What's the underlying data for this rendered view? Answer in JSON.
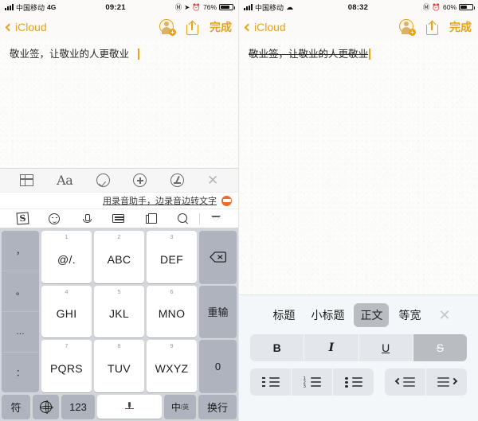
{
  "left": {
    "status": {
      "carrier": "中国移动",
      "network": "4G",
      "time": "09:21",
      "battery_pct": "76%",
      "icons": [
        "signal-icon",
        "at-icon",
        "location-arrow-icon",
        "alarm-clock-icon",
        "battery-icon"
      ]
    },
    "nav": {
      "back_label": "iCloud",
      "done_label": "完成",
      "icons": [
        "back-chevron-icon",
        "add-collaborator-icon",
        "share-icon"
      ]
    },
    "note": {
      "text": "敬业签，让敬业的人更敬业",
      "strikethrough": false,
      "caret_visible": true
    },
    "notes_toolbar": {
      "items": [
        {
          "name": "table-icon",
          "label": ""
        },
        {
          "name": "text-format-icon",
          "label": "Aa"
        },
        {
          "name": "checklist-icon",
          "label": ""
        },
        {
          "name": "add-attachment-icon",
          "label": ""
        },
        {
          "name": "markup-pen-icon",
          "label": ""
        },
        {
          "name": "close-icon",
          "label": "✕"
        }
      ]
    },
    "ime": {
      "ad_text": "用录音助手，边录音边转文字",
      "ad_icon": "recorder-emoji-icon",
      "tools": [
        "sogou-logo-icon",
        "emoji-icon",
        "voice-input-icon",
        "keyboard-switch-icon",
        "clipboard-icon",
        "search-icon",
        "collapse-keyboard-icon"
      ]
    },
    "keypad": {
      "punctuation": [
        "，",
        "。",
        "…",
        "："
      ],
      "keys": [
        {
          "num": "1",
          "label": "@/."
        },
        {
          "num": "2",
          "label": "ABC"
        },
        {
          "num": "3",
          "label": "DEF"
        },
        {
          "num": "4",
          "label": "GHI"
        },
        {
          "num": "5",
          "label": "JKL"
        },
        {
          "num": "6",
          "label": "MNO"
        },
        {
          "num": "7",
          "label": "PQRS"
        },
        {
          "num": "8",
          "label": "TUV"
        },
        {
          "num": "9",
          "label": "WXYZ"
        }
      ],
      "right_keys": [
        {
          "name": "delete-key",
          "label": ""
        },
        {
          "name": "redo-key",
          "label": "重输"
        },
        {
          "name": "zero-key",
          "label": "0"
        }
      ],
      "bottom_keys": [
        {
          "name": "symbols-key",
          "label": "符"
        },
        {
          "name": "globe-key",
          "label": ""
        },
        {
          "name": "numbers-key",
          "label": "123"
        },
        {
          "name": "space-key",
          "label": ""
        },
        {
          "name": "language-toggle-key",
          "label": "中",
          "sub": "/英"
        },
        {
          "name": "enter-key",
          "label": "换行"
        }
      ]
    }
  },
  "right": {
    "status": {
      "carrier": "中国移动",
      "network": "wifi",
      "time": "08:32",
      "battery_pct": "60%",
      "icons": [
        "signal-icon",
        "wifi-icon",
        "at-icon",
        "alarm-clock-icon",
        "battery-icon"
      ]
    },
    "nav": {
      "back_label": "iCloud",
      "done_label": "完成",
      "icons": [
        "back-chevron-icon",
        "add-collaborator-icon",
        "share-icon"
      ]
    },
    "note": {
      "text": "敬业签，让敬业的人更敬业",
      "strikethrough": true,
      "caret_visible": true
    },
    "format_panel": {
      "styles": [
        {
          "label": "标题",
          "active": false
        },
        {
          "label": "小标题",
          "active": false
        },
        {
          "label": "正文",
          "active": true
        },
        {
          "label": "等宽",
          "active": false
        }
      ],
      "close_label": "✕",
      "text_styles": [
        {
          "name": "bold-button",
          "label": "B",
          "active": false
        },
        {
          "name": "italic-button",
          "label": "I",
          "active": false
        },
        {
          "name": "underline-button",
          "label": "U",
          "active": false
        },
        {
          "name": "strikethrough-button",
          "label": "S",
          "active": true
        }
      ],
      "list_buttons": [
        {
          "name": "dashed-list-button"
        },
        {
          "name": "numbered-list-button"
        },
        {
          "name": "bulleted-list-button"
        }
      ],
      "indent_buttons": [
        {
          "name": "outdent-button"
        },
        {
          "name": "indent-button"
        }
      ]
    }
  },
  "colors": {
    "accent": "#e8a317",
    "keyboard_bg": "#d2d5da",
    "key_bg": "#ffffff",
    "fn_key_bg": "#aeb3bd",
    "format_panel_bg": "#f4f7fa",
    "active_seg": "#b9bcc0",
    "seg_bg": "#e3e7ec",
    "note_bg": "#fcfcfa"
  }
}
